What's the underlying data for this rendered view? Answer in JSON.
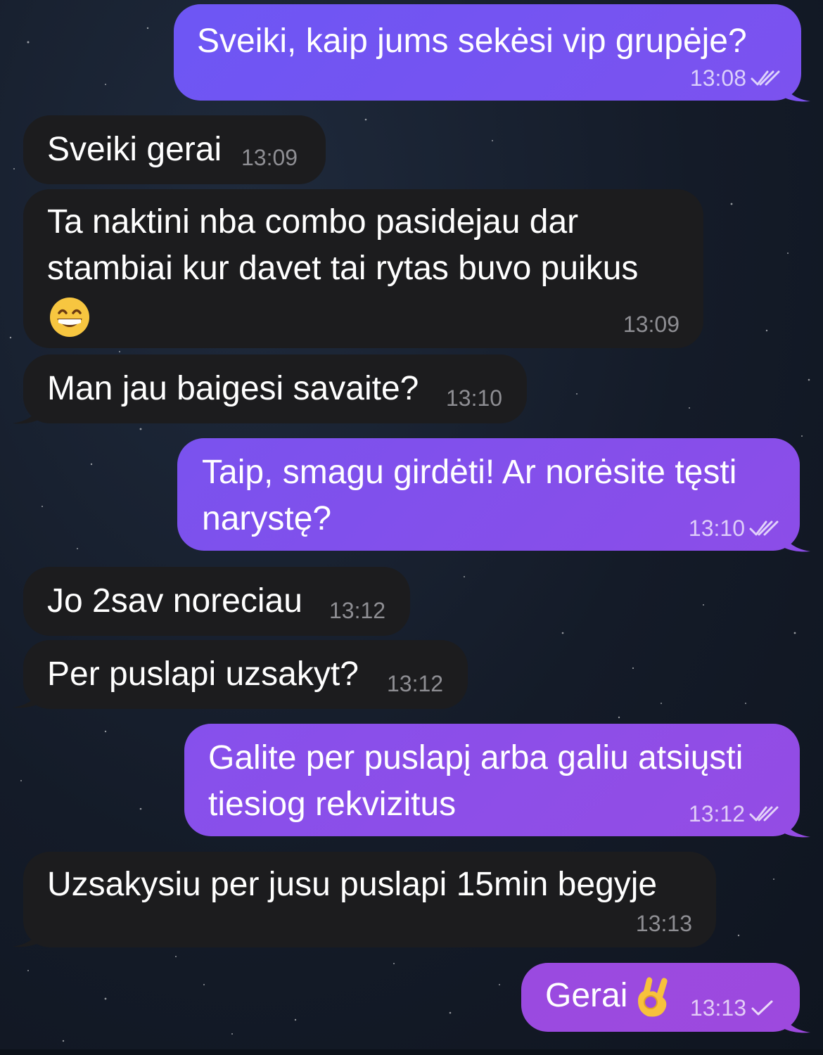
{
  "messages": [
    {
      "dir": "out",
      "text": "Sveiki, kaip jums sekėsi vip grupėje?",
      "time": "13:08",
      "status": "read"
    },
    {
      "dir": "in",
      "text": "Sveiki gerai",
      "time": "13:09"
    },
    {
      "dir": "in",
      "text": "Ta naktini nba combo pasidejau dar stambiai kur davet tai rytas buvo puikus",
      "emoji": "grinning-face-with-smiling-eyes",
      "time": "13:09"
    },
    {
      "dir": "in",
      "text": "Man jau baigesi savaite?",
      "time": "13:10"
    },
    {
      "dir": "out",
      "text": "Taip, smagu girdėti! Ar norėsite tęsti narystę?",
      "time": "13:10",
      "status": "read"
    },
    {
      "dir": "in",
      "text": "Jo 2sav noreciau",
      "time": "13:12"
    },
    {
      "dir": "in",
      "text": "Per puslapi uzsakyt?",
      "time": "13:12"
    },
    {
      "dir": "out",
      "text": "Galite per puslapį arba galiu atsiųsti tiesiog rekvizitus",
      "time": "13:12",
      "status": "read"
    },
    {
      "dir": "in",
      "text": "Uzsakysiu per jusu puslapi 15min begyje",
      "time": "13:13"
    },
    {
      "dir": "out",
      "text": "Gerai",
      "emoji": "ok-hand",
      "time": "13:13",
      "status": "sent"
    }
  ],
  "colors": {
    "incoming_bubble": "#1c1c1e",
    "outgoing_gradient": [
      "#6a55f2",
      "#9a4ae0"
    ],
    "background": "#141b28"
  }
}
